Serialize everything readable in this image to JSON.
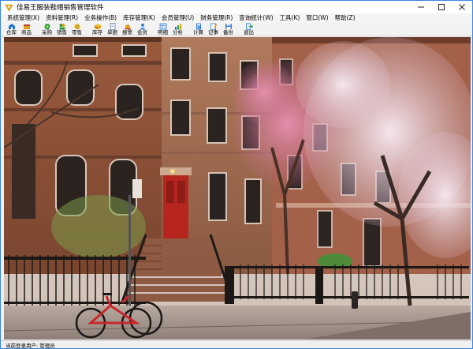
{
  "window": {
    "title": "佳易王服装鞋帽销售管理软件"
  },
  "menu": [
    {
      "label": "系统管理(X)"
    },
    {
      "label": "资料管理(R)"
    },
    {
      "label": "业务操作(B)"
    },
    {
      "label": "库存管理(K)"
    },
    {
      "label": "会员管理(U)"
    },
    {
      "label": "财务管理(R)"
    },
    {
      "label": "查询统计(W)"
    },
    {
      "label": "工具(K)"
    },
    {
      "label": "窗口(W)"
    },
    {
      "label": "帮助(Z)"
    }
  ],
  "toolbar": [
    {
      "label": "仓库",
      "icon": "warehouse-icon",
      "color": "#1a6fd1"
    },
    {
      "label": "商品",
      "icon": "goods-icon",
      "color": "#e0a21a"
    },
    {
      "label": "采购",
      "icon": "purchase-icon",
      "color": "#2a9d3a"
    },
    {
      "label": "销售",
      "icon": "sales-icon",
      "color": "#2a9d3a"
    },
    {
      "label": "零售",
      "icon": "retail-icon",
      "color": "#e0a21a"
    },
    {
      "label": "库存",
      "icon": "inventory-icon",
      "color": "#e0a21a"
    },
    {
      "label": "单据",
      "icon": "document-icon",
      "color": "#6a7fb0"
    },
    {
      "label": "报警",
      "icon": "alarm-icon",
      "color": "#e0a21a"
    },
    {
      "label": "会员",
      "icon": "member-icon",
      "color": "#3a7fd0"
    },
    {
      "label": "明细",
      "icon": "detail-icon",
      "color": "#3a7fd0"
    },
    {
      "label": "分析",
      "icon": "analysis-icon",
      "color": "#1a6fd1"
    },
    {
      "label": "计算",
      "icon": "calculator-icon",
      "color": "#3a7fd0"
    },
    {
      "label": "记事",
      "icon": "notepad-icon",
      "color": "#3a7fd0"
    },
    {
      "label": "备份",
      "icon": "backup-icon",
      "color": "#3a7fd0"
    },
    {
      "label": "退出",
      "icon": "exit-icon",
      "color": "#3a7fd0"
    }
  ],
  "status": {
    "text": "当前登录用户: 管理员"
  }
}
